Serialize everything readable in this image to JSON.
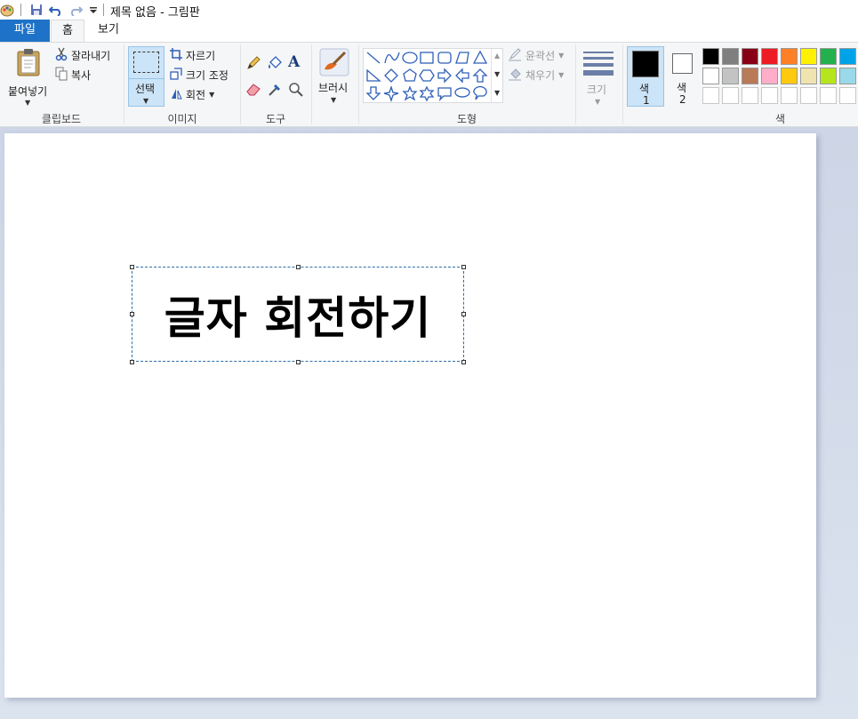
{
  "window": {
    "title": "제목 없음 - 그림판"
  },
  "tabs": [
    {
      "label": "파일"
    },
    {
      "label": "홈"
    },
    {
      "label": "보기"
    }
  ],
  "clipboard": {
    "paste": "붙여넣기",
    "cut": "잘라내기",
    "copy": "복사",
    "group": "클립보드"
  },
  "image": {
    "select": "선택",
    "crop": "자르기",
    "resize": "크기 조정",
    "rotate": "회전",
    "group": "이미지"
  },
  "tools": {
    "group": "도구"
  },
  "brush": {
    "label": "브러시"
  },
  "shapes": {
    "outline": "윤곽선",
    "fill": "채우기",
    "group": "도형"
  },
  "size": {
    "label": "크기"
  },
  "colors": {
    "color1_label": "색",
    "color1_num": "1",
    "color2_label": "색",
    "color2_num": "2",
    "group": "색",
    "color1": "#000000",
    "color2": "#ffffff",
    "palette_row1": [
      "#000000",
      "#7f7f7f",
      "#880015",
      "#ed1c24",
      "#ff7f27",
      "#fff200",
      "#22b14c",
      "#00a2e8"
    ],
    "palette_row2": [
      "#ffffff",
      "#c3c3c3",
      "#b97a57",
      "#ffaec9",
      "#ffc90e",
      "#efe4b0",
      "#b5e61d",
      "#99d9ea"
    ],
    "palette_row3": [
      "#ffffff",
      "#ffffff",
      "#ffffff",
      "#ffffff",
      "#ffffff",
      "#ffffff",
      "#ffffff",
      "#ffffff"
    ]
  },
  "canvas": {
    "text": "글자 회전하기"
  }
}
